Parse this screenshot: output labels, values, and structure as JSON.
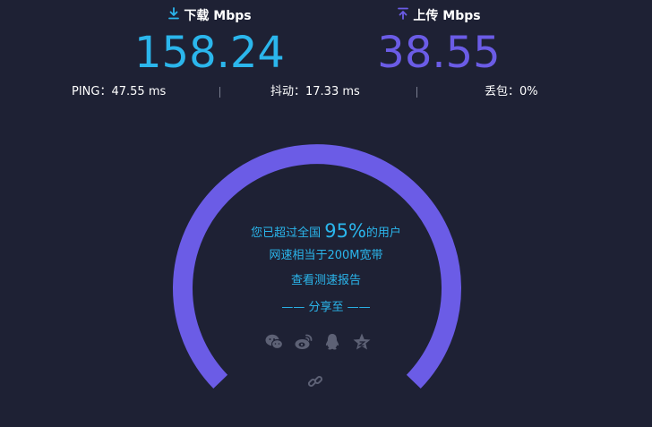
{
  "download": {
    "label": "下载 Mbps",
    "value": "158.24",
    "icon": "download-icon"
  },
  "upload": {
    "label": "上传 Mbps",
    "value": "38.55",
    "icon": "upload-icon"
  },
  "stats": {
    "ping": "PING：47.55 ms",
    "jitter": "抖动：17.33 ms",
    "loss": "丢包：0%"
  },
  "result": {
    "rank_prefix": "您已超过全国",
    "rank_percent": "95%",
    "rank_suffix": "的用户",
    "equivalent": "网速相当于200M宽带",
    "report_link": "查看测速报告",
    "share_label": "—— 分享至 ——"
  },
  "share_icons": [
    "wechat-icon",
    "weibo-icon",
    "qq-icon",
    "qzone-icon"
  ],
  "copy_link_icon": "link-icon",
  "colors": {
    "background": "#1e2134",
    "download": "#2bb6ec",
    "upload": "#6b5ce6",
    "gauge": "#6b5ce6",
    "icon_gray": "#5d6175"
  }
}
